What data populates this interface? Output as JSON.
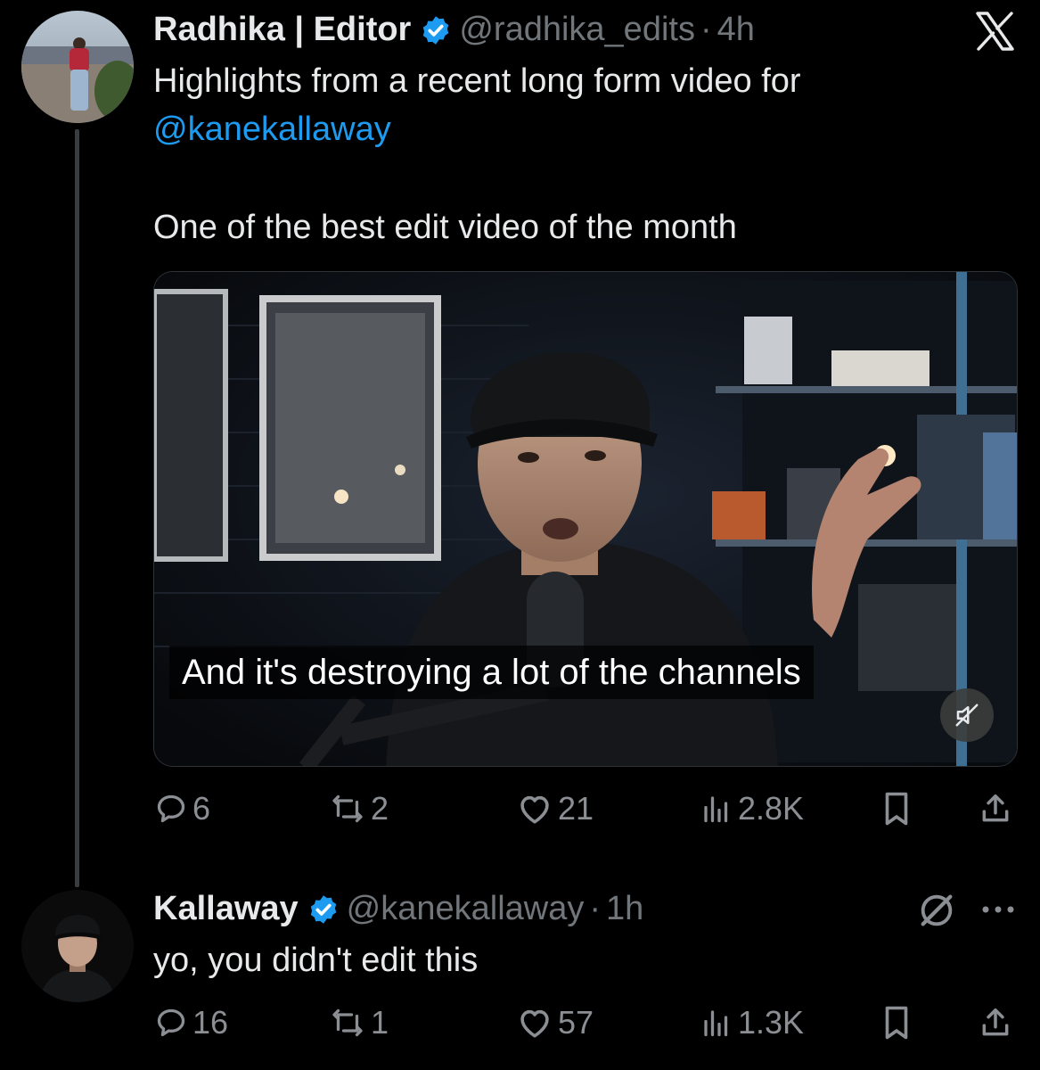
{
  "tweet1": {
    "display_name": "Radhika | Editor",
    "handle": "@radhika_edits",
    "dot": "·",
    "time": "4h",
    "text_line1": "Highlights from a recent long form video for",
    "mention": "@kanekallaway",
    "text_line2": "One of the best edit video of the month",
    "video_caption": "And it's destroying a lot of the channels",
    "stats": {
      "replies": "6",
      "reposts": "2",
      "likes": "21",
      "views": "2.8K"
    }
  },
  "tweet2": {
    "display_name": "Kallaway",
    "handle": "@kanekallaway",
    "dot": "·",
    "time": "1h",
    "text": "yo, you didn't edit this",
    "stats": {
      "replies": "16",
      "reposts": "1",
      "likes": "57",
      "views": "1.3K"
    }
  },
  "icons": {
    "brand": "x-logo-icon",
    "verified": "verified-badge-icon",
    "reply": "reply-icon",
    "repost": "repost-icon",
    "like": "heart-icon",
    "views": "views-chart-icon",
    "bookmark": "bookmark-icon",
    "share": "share-icon",
    "mute": "muted-speaker-icon",
    "grok": "grok-icon",
    "more": "more-dots-icon"
  },
  "colors": {
    "background": "#000000",
    "text": "#e7e9ea",
    "secondary": "#71767b",
    "link": "#1d9bf0",
    "verified": "#1d9bf0",
    "action": "#8b8f94"
  }
}
